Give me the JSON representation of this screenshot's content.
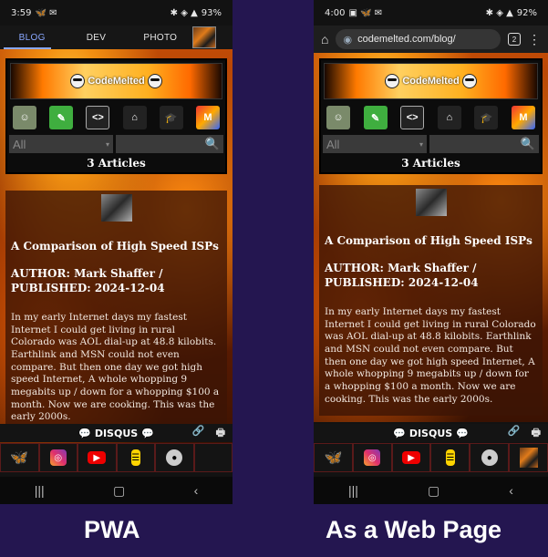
{
  "pwa": {
    "status_time": "3:59",
    "battery": "93%",
    "tabs": [
      "BLOG",
      "DEV",
      "PHOTO"
    ],
    "caption": "PWA"
  },
  "web": {
    "status_time": "4:00",
    "battery": "92%",
    "url": "codemelted.com/blog/",
    "tab_count": "2",
    "caption": "As a Web Page"
  },
  "site": {
    "logo_text": "CodeMelted",
    "filter_value": "All",
    "articles_count": "3 Articles",
    "disqus_label": "💬 DISQUS 💬",
    "link_glyph": "🔗",
    "print_glyph": "🖶"
  },
  "article": {
    "title": "A Comparison of High Speed ISPs",
    "author": "AUTHOR: Mark Shaffer / PUBLISHED: 2024-12-04",
    "body": "In my early Internet days my fastest Internet I could get living in rural Colorado was AOL dial-up at 48.8 kilobits. Earthlink and MSN could not even compare. But then one day we got high speed Internet, A whole whopping 9 megabits up / down for a whopping $100 a month. Now we are cooking. This was the early 2000s."
  },
  "colors": {
    "tab_active": "#8aa8ff",
    "background": "#241650"
  }
}
